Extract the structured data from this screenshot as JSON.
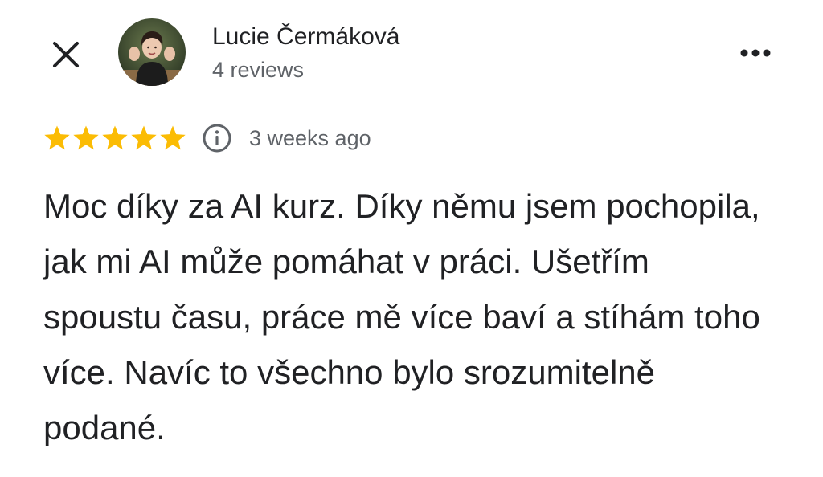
{
  "header": {
    "close_icon": "close-icon",
    "author_name": "Lucie Čermáková",
    "review_count": "4 reviews",
    "more_icon": "more-options-icon"
  },
  "rating": {
    "stars": 5,
    "max_stars": 5,
    "star_color": "#fbbc04",
    "info_icon": "info-icon",
    "date": "3 weeks ago"
  },
  "review": {
    "text": "Moc díky za AI kurz. Díky němu jsem pochopila, jak mi AI může pomáhat v práci. Ušetřím spoustu času, práce mě více baví a stíhám toho více. Navíc to všechno bylo srozumitelně podané."
  },
  "colors": {
    "text_primary": "#202124",
    "text_secondary": "#5f6368",
    "background": "#ffffff"
  }
}
